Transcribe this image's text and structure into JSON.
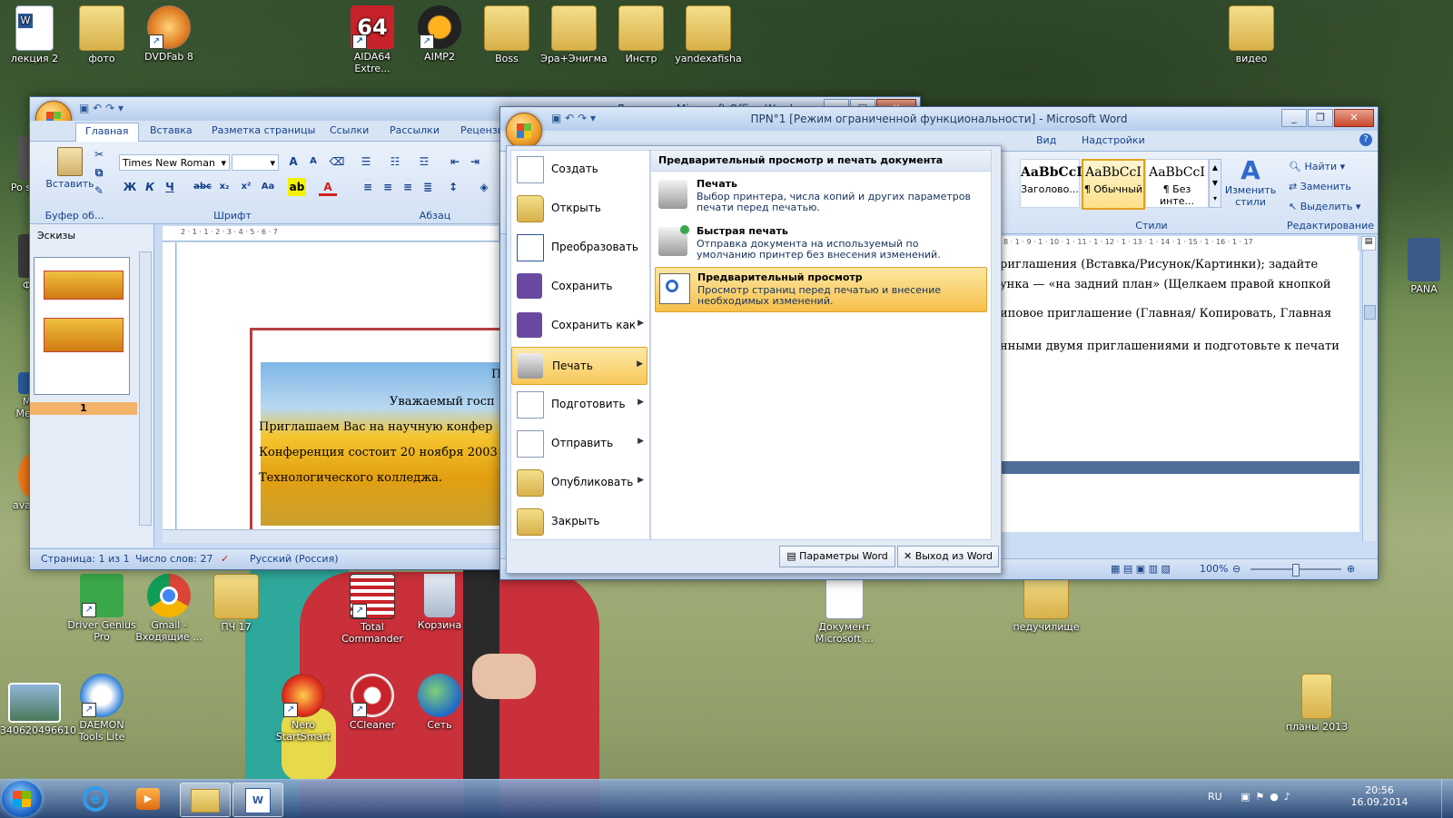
{
  "desktop": {
    "icons_top": [
      {
        "id": "lecture",
        "label": "лекция 2"
      },
      {
        "id": "photo",
        "label": "фото"
      },
      {
        "id": "dvdfab",
        "label": "DVDFab 8"
      },
      {
        "id": "aida",
        "label": "AIDA64 Extre..."
      },
      {
        "id": "aimp",
        "label": "AIMP2"
      },
      {
        "id": "boss",
        "label": "Boss"
      },
      {
        "id": "era",
        "label": "Эра+Энигма"
      },
      {
        "id": "instr",
        "label": "Инстр"
      },
      {
        "id": "yandex",
        "label": "yandexafisha"
      },
      {
        "id": "video",
        "label": "видео"
      }
    ],
    "icons_left": [
      {
        "id": "po",
        "label": "Po sove"
      },
      {
        "id": "fo",
        "label": "Фо"
      },
      {
        "id": "ma",
        "label": "Ma Меди"
      },
      {
        "id": "avast",
        "label": "ava An"
      }
    ],
    "icon_right": {
      "label": "PANA"
    },
    "aida_glyph": "64",
    "icons_bottom": [
      {
        "id": "driver",
        "label": "Driver Genius Pro"
      },
      {
        "id": "gmail",
        "label": "Gmail - Входящие ..."
      },
      {
        "id": "pch",
        "label": "ПЧ 17"
      },
      {
        "id": "totalcmd",
        "label": "Total Commander"
      },
      {
        "id": "recycle",
        "label": "Корзина"
      },
      {
        "id": "msdoc",
        "label": "Документ Microsoft ..."
      },
      {
        "id": "pedu",
        "label": "педучилище"
      },
      {
        "id": "photo2",
        "label": "340620496610"
      },
      {
        "id": "daemon",
        "label": "DAEMON Tools Lite"
      },
      {
        "id": "nero",
        "label": "Nero StartSmart"
      },
      {
        "id": "ccleaner",
        "label": "CCleaner"
      },
      {
        "id": "net",
        "label": "Сеть"
      },
      {
        "id": "plans",
        "label": "планы 2013"
      }
    ]
  },
  "back_window": {
    "title": "Документ Microsoft Office Word",
    "tabs": [
      "Главная",
      "Вставка",
      "Разметка страницы",
      "Ссылки",
      "Рассылки",
      "Рецензи"
    ],
    "font_name": "Times New Roman",
    "font_size": "",
    "paste_label": "Вставить",
    "group_labels": {
      "clipboard": "Буфер об...",
      "font": "Шрифт",
      "paragraph": "Абзац"
    },
    "thumbs_title": "Эскизы",
    "thumb_page": "1",
    "ruler_text": "2 · 1 · 1 · 2 · 3 · 4 · 5 · 6 · 7",
    "doc_lines": [
      "П",
      "Уважаемый госп",
      "Приглашаем Вас на научную конфер",
      "Конференция состоит 20 ноября 2003",
      "Технологического колледжа."
    ],
    "status": {
      "page": "Страница: 1 из 1",
      "words": "Число слов: 27",
      "lang": "Русский (Россия)"
    }
  },
  "front_window": {
    "title": "ПРN°1 [Режим ограниченной функциональности] - Microsoft Word",
    "tabs": [
      "Вид",
      "Надстройки"
    ],
    "styles": [
      {
        "sample": "AaBbCcI",
        "name": "Заголово..."
      },
      {
        "sample": "AaBbCcI",
        "name": "¶ Обычный"
      },
      {
        "sample": "AaBbCcI",
        "name": "¶ Без инте..."
      }
    ],
    "change_styles": "Изменить стили",
    "styles_group": "Стили",
    "editing": {
      "find": "Найти",
      "replace": "Заменить",
      "select": "Выделить",
      "label": "Редактирование"
    },
    "ruler_text": "8 · 1 · 9 · 1 · 10 · 1 · 11 · 1 · 12 · 1 · 13 · 1 · 14 · 1 · 15 · 1 · 16 · 1 · 17",
    "doc_lines": [
      "риглашения  (Вставка/Рисунок/Картинки);  задайте",
      "унка — «на задний план» (Щелкаем правой кнопкой",
      "иповое приглашение (Главная/ Копировать, Главная",
      "нными двумя приглашениями и подготовьте к печати"
    ],
    "zoom": "100%"
  },
  "office_menu": {
    "items": [
      {
        "label": "Создать",
        "arrow": false
      },
      {
        "label": "Открыть",
        "arrow": false
      },
      {
        "label": "Преобразовать",
        "arrow": false
      },
      {
        "label": "Сохранить",
        "arrow": false
      },
      {
        "label": "Сохранить как",
        "arrow": true
      },
      {
        "label": "Печать",
        "arrow": true
      },
      {
        "label": "Подготовить",
        "arrow": true
      },
      {
        "label": "Отправить",
        "arrow": true
      },
      {
        "label": "Опубликовать",
        "arrow": true
      },
      {
        "label": "Закрыть",
        "arrow": false
      }
    ],
    "submenu_title": "Предварительный просмотр и печать документа",
    "submenu": [
      {
        "title": "Печать",
        "desc": "Выбор принтера, числа копий и других параметров печати перед печатью."
      },
      {
        "title": "Быстрая печать",
        "desc": "Отправка документа на используемый по умолчанию принтер без внесения изменений."
      },
      {
        "title": "Предварительный просмотр",
        "desc": "Просмотр страниц перед печатью и внесение необходимых изменений."
      }
    ],
    "options_btn": "Параметры Word",
    "exit_btn": "Выход из Word"
  },
  "taskbar": {
    "lang": "RU",
    "time": "20:56",
    "date": "16.09.2014"
  }
}
